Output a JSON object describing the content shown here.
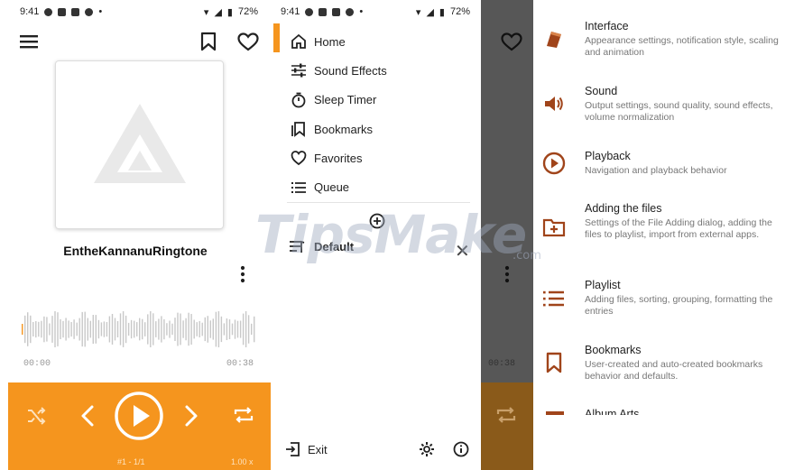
{
  "player": {
    "status_time": "9:41",
    "status_battery": "72%",
    "track_title": "EntheKannanuRingtone",
    "time_elapsed": "00:00",
    "time_total": "00:38",
    "queue_position": "#1 - 1/1",
    "speed": "1.00 x",
    "accent_color": "#f5951e"
  },
  "drawer": {
    "status_time": "9:41",
    "status_battery": "72%",
    "items": [
      {
        "label": "Home",
        "icon": "home-icon"
      },
      {
        "label": "Sound Effects",
        "icon": "equalizer-icon"
      },
      {
        "label": "Sleep Timer",
        "icon": "timer-icon"
      },
      {
        "label": "Bookmarks",
        "icon": "bookmarks-icon"
      },
      {
        "label": "Favorites",
        "icon": "heart-icon"
      },
      {
        "label": "Queue",
        "icon": "queue-icon"
      }
    ],
    "playlist_label": "Default",
    "exit_label": "Exit"
  },
  "overlay": {
    "time_total": "00:38"
  },
  "settings": {
    "items": [
      {
        "title": "Interface",
        "desc": "Appearance settings, notification style, scaling and animation",
        "icon": "palette-icon"
      },
      {
        "title": "Sound",
        "desc": "Output settings, sound quality, sound effects, volume normalization",
        "icon": "speaker-icon"
      },
      {
        "title": "Playback",
        "desc": "Navigation and playback behavior",
        "icon": "play-circle-icon"
      },
      {
        "title": "Adding the files",
        "desc": "Settings of the File Adding dialog, adding the files to playlist, import from external apps.",
        "icon": "folder-add-icon"
      },
      {
        "title": "Playlist",
        "desc": "Adding files, sorting, grouping, formatting the entries",
        "icon": "list-icon"
      },
      {
        "title": "Bookmarks",
        "desc": "User-created and auto-created bookmarks behavior and defaults.",
        "icon": "bookmark-icon"
      },
      {
        "title": "Album Arts",
        "desc": "",
        "icon": "album-art-icon"
      }
    ],
    "icon_color": "#a0441a"
  },
  "watermark": {
    "text": "TipsMake",
    "suffix": ".com"
  }
}
